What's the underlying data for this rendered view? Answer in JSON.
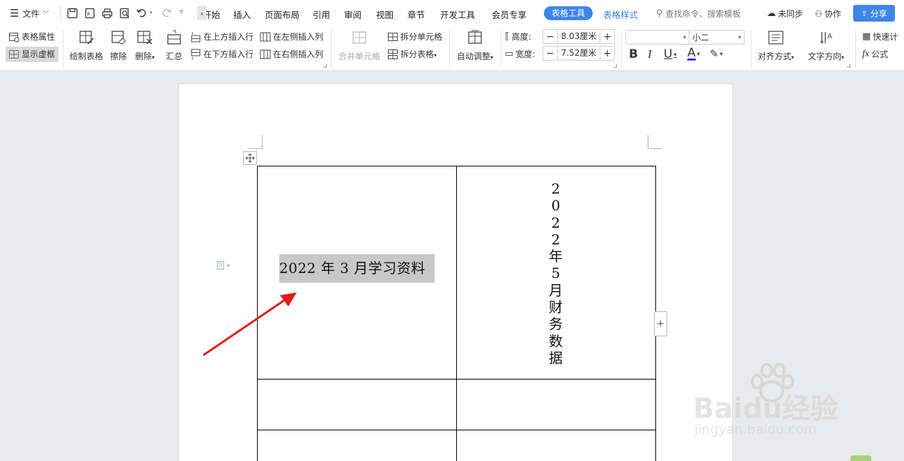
{
  "titlebar": {
    "file_menu": "文件",
    "tabs": [
      "开始",
      "插入",
      "页面布局",
      "引用",
      "审阅",
      "视图",
      "章节",
      "开发工具",
      "会员专享"
    ],
    "active_tab": "表格工具",
    "style_tab": "表格样式",
    "search_placeholder": "查找命令、搜索模板",
    "sync_label": "未同步",
    "collab_label": "协作",
    "share_label": "分享"
  },
  "ribbon": {
    "table_properties": "表格属性",
    "show_gridlines": "显示虚框",
    "draw_table": "绘制表格",
    "erase": "擦除",
    "delete": "删除",
    "summary": "汇总",
    "insert_row_above": "在上方插入行",
    "insert_row_below": "在下方插入行",
    "insert_col_left": "在左侧插入列",
    "insert_col_right": "在右侧插入列",
    "merge_cells": "合并单元格",
    "split_cells": "拆分单元格",
    "split_table": "拆分表格",
    "auto_fit": "自动调整",
    "height_label": "高度:",
    "height_value": "8.03厘米",
    "width_label": "宽度:",
    "width_value": "7.52厘米",
    "font_name": "",
    "font_size": "小二",
    "align": "对齐方式",
    "text_direction": "文字方向",
    "quick_calc": "快速计",
    "formula": "公式"
  },
  "document": {
    "cell_1_text": "2022 年 3 月学习资料",
    "cell_2_chars": [
      "2",
      "0",
      "2",
      "2",
      "年",
      "5",
      "月",
      "财",
      "务",
      "数",
      "据"
    ]
  },
  "watermark": {
    "brand": "Baidu经验",
    "url": "jingyan.baidu.com"
  },
  "colors": {
    "accent": "#3d86e8",
    "selection": "#c8c8c8",
    "arrow": "#e01b1b"
  }
}
